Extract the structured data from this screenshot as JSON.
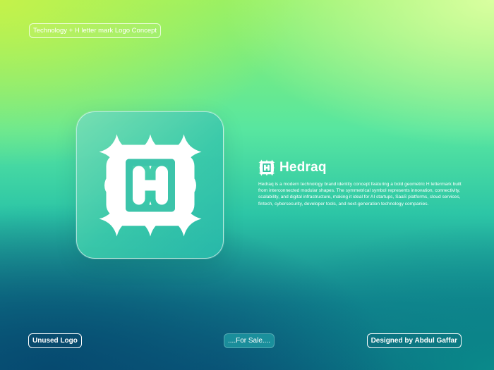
{
  "header": {
    "title": "Technology + H letter mark Logo Concept"
  },
  "brand": {
    "name": "Hedraq",
    "icon": "hedraq-logo-icon",
    "description": "Hedraq is a modern technology brand identity concept featuring a bold geometric H lettermark built from interconnected modular shapes. The symmetrical symbol represents innovation, connectivity, scalability, and digital infrastructure, making it ideal for AI startups, SaaS platforms, cloud services, fintech, cybersecurity, developer tools, and next-generation technology companies."
  },
  "logo_card": {
    "icon": "hedraq-lettermark-icon"
  },
  "footer": {
    "unused_label": "Unused Logo",
    "sale_label": "....For Sale....",
    "designer_label": "Designed by Abdul Gaffar"
  },
  "colors": {
    "lime": "#c4f24a",
    "mint": "#58e6a0",
    "teal": "#2cc5a6",
    "deep_blue": "#0c5f7e",
    "white": "#ffffff"
  }
}
